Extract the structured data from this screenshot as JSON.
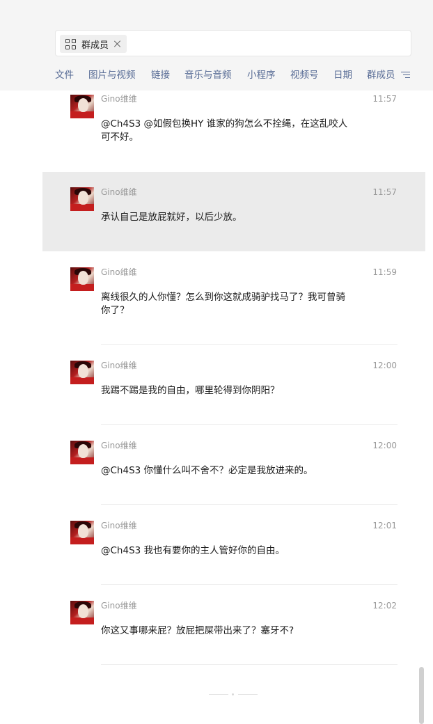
{
  "filter": {
    "tag_label": "群成员"
  },
  "tabs": [
    {
      "label": "文件"
    },
    {
      "label": "图片与视频"
    },
    {
      "label": "链接"
    },
    {
      "label": "音乐与音频"
    },
    {
      "label": "小程序"
    },
    {
      "label": "视频号"
    },
    {
      "label": "日期"
    },
    {
      "label": "群成员"
    }
  ],
  "messages": [
    {
      "sender": "Gino维维",
      "time": "11:57",
      "text": "@Ch4S3 @如假包换HY 谁家的狗怎么不拴绳，在这乱咬人可不好。",
      "highlighted": false
    },
    {
      "sender": "Gino维维",
      "time": "11:57",
      "text": "承认自己是放屁就好，以后少放。",
      "highlighted": true
    },
    {
      "sender": "Gino维维",
      "time": "11:59",
      "text": "离线很久的人你懂？怎么到你这就成骑驴找马了？我可曾骑你了？",
      "highlighted": false
    },
    {
      "sender": "Gino维维",
      "time": "12:00",
      "text": "我踢不踢是我的自由，哪里轮得到你阴阳？",
      "highlighted": false
    },
    {
      "sender": "Gino维维",
      "time": "12:00",
      "text": "@Ch4S3 你懂什么叫不舍不？必定是我放进来的。",
      "highlighted": false
    },
    {
      "sender": "Gino维维",
      "time": "12:01",
      "text": "@Ch4S3 我也有要你的主人管好你的自由。",
      "highlighted": false
    },
    {
      "sender": "Gino维维",
      "time": "12:02",
      "text": "你这又事哪来屁？放屁把屎带出来了？塞牙不?",
      "highlighted": false
    }
  ],
  "colors": {
    "header_bg": "#f5f5f5",
    "tab_link": "#576b95",
    "meta_text": "#999999",
    "highlight_bg": "#ebebeb"
  },
  "icons": {
    "tag_icon": "grid-icon",
    "tag_remove": "close-icon",
    "filter_menu": "filter-lines-icon"
  }
}
